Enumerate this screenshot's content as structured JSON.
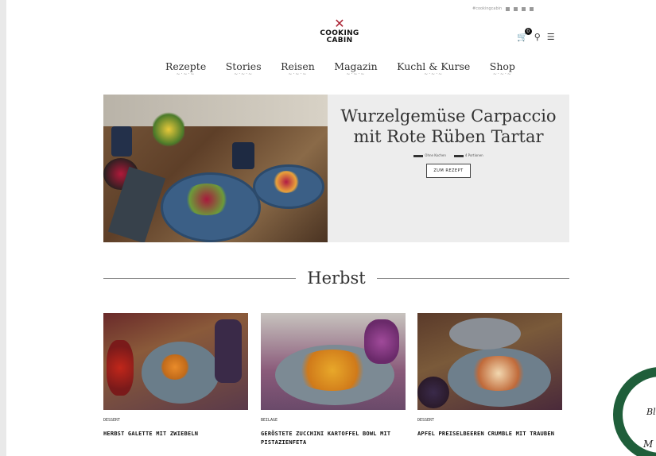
{
  "header": {
    "utility_text": "#cookingcabin",
    "logo_line1": "COOKING",
    "logo_line2": "CABIN",
    "cart_count": "0",
    "icons": [
      "cart-icon",
      "search-icon",
      "menu-icon"
    ]
  },
  "nav": {
    "items": [
      {
        "label": "Rezepte"
      },
      {
        "label": "Stories"
      },
      {
        "label": "Reisen"
      },
      {
        "label": "Magazin"
      },
      {
        "label": "Kuchl & Kurse"
      },
      {
        "label": "Shop"
      }
    ],
    "ornament": "~·~·~"
  },
  "hero": {
    "title": "Wurzelgemüse Carpaccio mit Rote Rüben Tartar",
    "meta1": "Ohne Kochen",
    "meta2": "4 Portionen",
    "button": "ZUM REZEPT"
  },
  "section": {
    "title": "Herbst"
  },
  "cards": [
    {
      "category": "DESSERT",
      "title": "HERBST GALETTE MIT ZWIEBELN"
    },
    {
      "category": "BEILAGE",
      "title": "GERÖSTETE ZUCCHINI KARTOFFEL BOWL MIT PISTAZIENFETA"
    },
    {
      "category": "DESSERT",
      "title": "APFEL PREISELBEEREN CRUMBLE MIT TRAUBEN"
    }
  ],
  "seal": {
    "line1": "Bl",
    "line2": "M"
  },
  "colors": {
    "seal": "#1f5e3a",
    "hero_panel": "#ededed"
  }
}
